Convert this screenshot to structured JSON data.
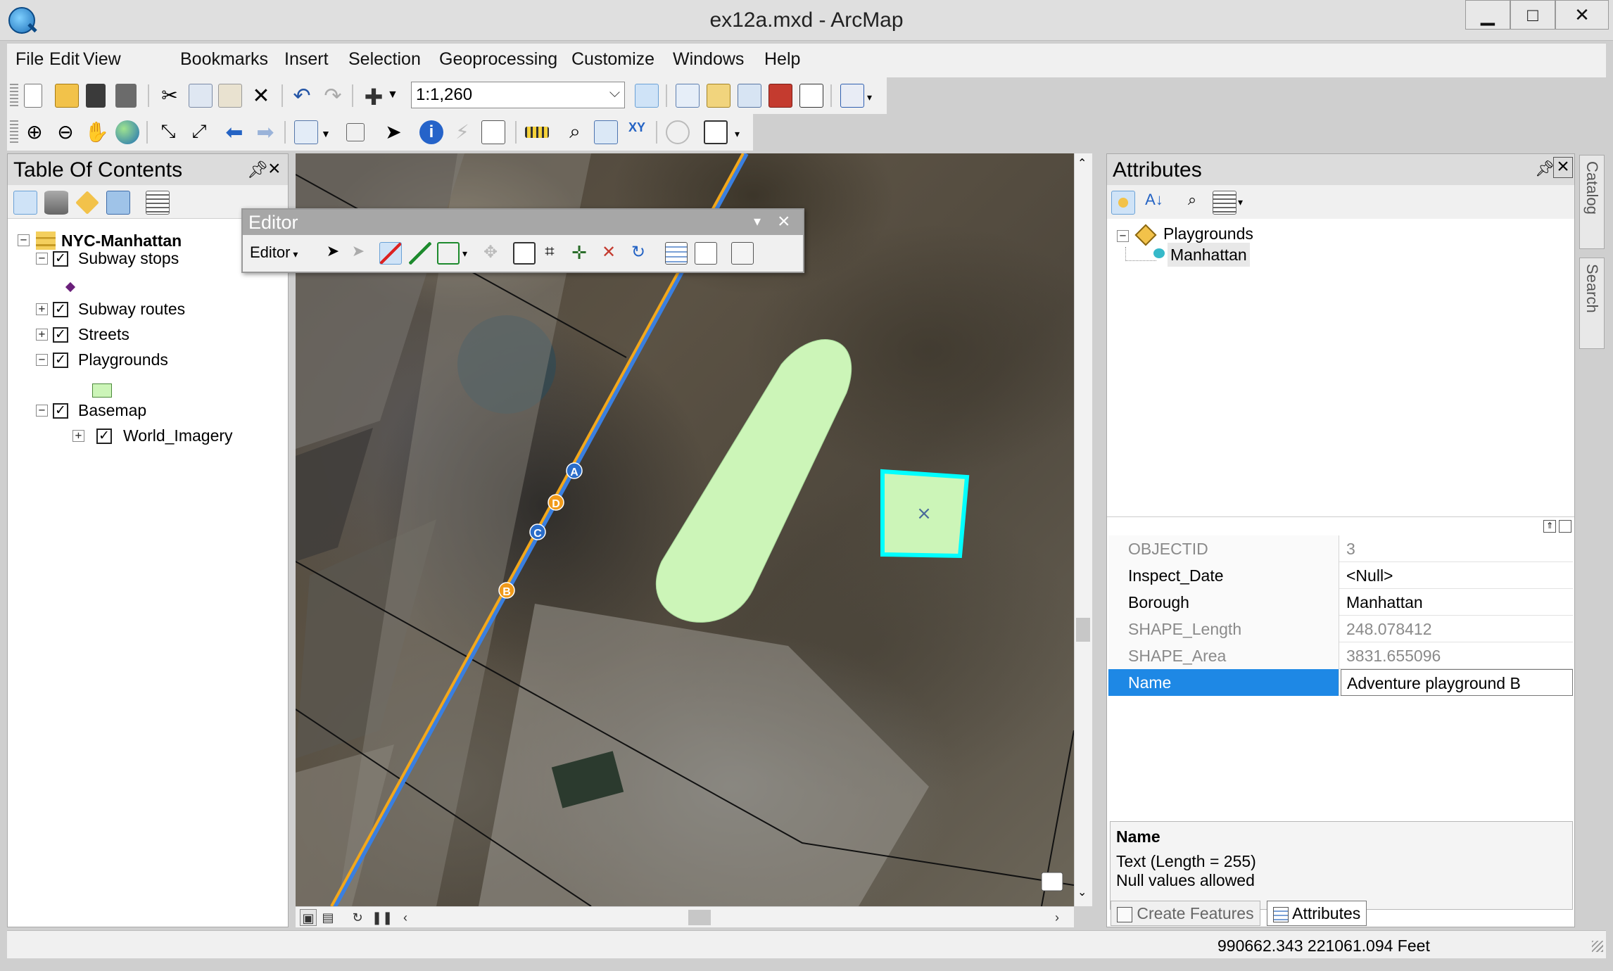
{
  "window": {
    "title": "ex12a.mxd - ArcMap"
  },
  "menu": [
    "File",
    "Edit",
    "View",
    "Bookmarks",
    "Insert",
    "Selection",
    "Geoprocessing",
    "Customize",
    "Windows",
    "Help"
  ],
  "toolbar": {
    "scale": "1:1,260"
  },
  "toc": {
    "title": "Table Of Contents",
    "data_frame": "NYC-Manhattan",
    "layers": [
      {
        "name": "Subway stops",
        "checked": true,
        "expanded": true
      },
      {
        "name": "Subway routes",
        "checked": true,
        "expanded": false
      },
      {
        "name": "Streets",
        "checked": true,
        "expanded": false
      },
      {
        "name": "Playgrounds",
        "checked": true,
        "expanded": true
      },
      {
        "name": "Basemap",
        "checked": true,
        "expanded": true
      },
      {
        "name": "World_Imagery",
        "checked": true,
        "expanded": false
      }
    ]
  },
  "editor": {
    "title": "Editor",
    "menu_label": "Editor"
  },
  "map": {
    "stations": [
      "A",
      "D",
      "C",
      "B"
    ],
    "colors": {
      "playground_fill": "#ccf5b8",
      "selection": "#00ffff",
      "subway_route": "#f2a71b",
      "street_line": "#3a7fe0"
    }
  },
  "attributes": {
    "title": "Attributes",
    "tree": {
      "layer": "Playgrounds",
      "feature": "Manhattan"
    },
    "rows": [
      {
        "field": "OBJECTID",
        "value": "3",
        "readonly": true
      },
      {
        "field": "Inspect_Date",
        "value": "<Null>",
        "readonly": false
      },
      {
        "field": "Borough",
        "value": "Manhattan",
        "readonly": false
      },
      {
        "field": "SHAPE_Length",
        "value": "248.078412",
        "readonly": true
      },
      {
        "field": "SHAPE_Area",
        "value": "3831.655096",
        "readonly": true
      },
      {
        "field": "Name",
        "value": "Adventure playground B",
        "readonly": false,
        "selected": true
      }
    ],
    "description": {
      "field": "Name",
      "type": "Text (Length = 255)",
      "nulls": "Null values allowed"
    }
  },
  "bottom_tabs": [
    "Create Features",
    "Attributes"
  ],
  "side_tabs": [
    "Catalog",
    "Search"
  ],
  "status": {
    "coords": "990662.343  221061.094 Feet"
  }
}
